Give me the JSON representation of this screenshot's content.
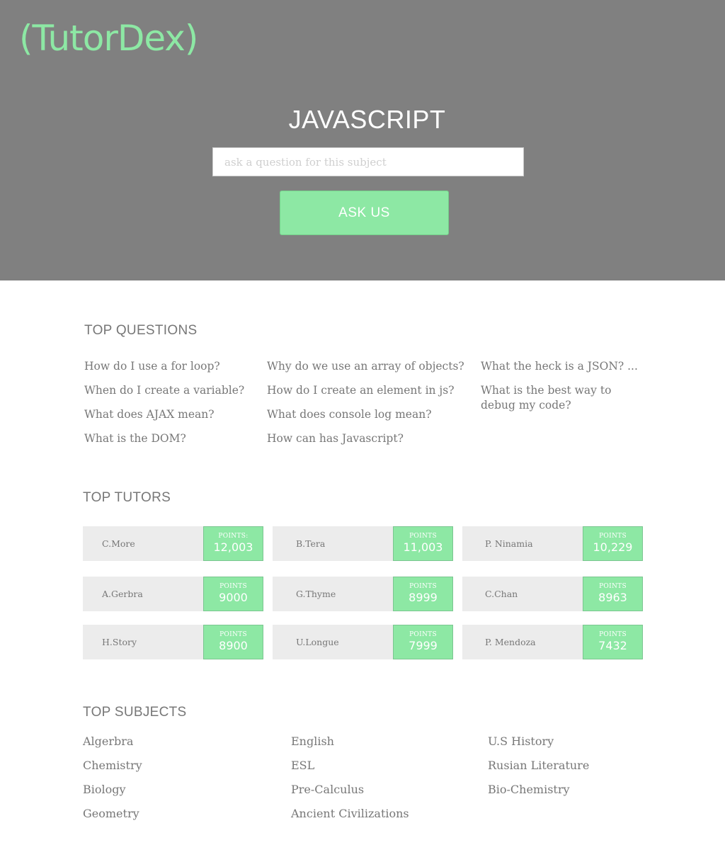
{
  "brand": {
    "logo": "(TutorDex)"
  },
  "hero": {
    "subject_title": "JAVASCRIPT",
    "search": {
      "value": "",
      "placeholder": "ask a question for this subject"
    },
    "ask_button_label": "ASK US"
  },
  "colors": {
    "header_bg": "#808080",
    "accent": "#8de8a4",
    "card_bg": "#ececec",
    "text": "#777777"
  },
  "top_questions": {
    "heading": "TOP QUESTIONS",
    "columns": [
      [
        "How do I use a for loop?",
        "When do I create a variable?",
        "What does AJAX mean?",
        "What is the DOM?"
      ],
      [
        "Why do we use an array of objects?",
        "How do I create an element in js?",
        "What does console log mean?",
        "How can has Javascript?"
      ],
      [
        "What the heck is a JSON? ...",
        "What is the best way to debug my code?"
      ]
    ]
  },
  "top_tutors": {
    "heading": "TOP TUTORS",
    "tutors": [
      {
        "name": "C.More",
        "points_label": "POINTS:",
        "points": "12,003"
      },
      {
        "name": "B.Tera",
        "points_label": "POINTS",
        "points": "11,003"
      },
      {
        "name": "P. Ninamia",
        "points_label": "POINTS",
        "points": "10,229"
      },
      {
        "name": "A.Gerbra",
        "points_label": "POINTS",
        "points": "9000"
      },
      {
        "name": "G.Thyme",
        "points_label": "POINTS",
        "points": "8999"
      },
      {
        "name": "C.Chan",
        "points_label": "POINTS",
        "points": "8963"
      },
      {
        "name": "H.Story",
        "points_label": "POINTS",
        "points": "8900"
      },
      {
        "name": "U.Longue",
        "points_label": "POINTS",
        "points": "7999"
      },
      {
        "name": "P. Mendoza",
        "points_label": "POINTS",
        "points": "7432"
      }
    ]
  },
  "top_subjects": {
    "heading": "TOP SUBJECTS",
    "columns": [
      [
        "Algerbra",
        "Chemistry",
        "Biology",
        "Geometry"
      ],
      [
        "English",
        "ESL",
        "Pre-Calculus",
        "Ancient Civilizations"
      ],
      [
        "U.S History",
        "Rusian Literature",
        "Bio-Chemistry"
      ]
    ]
  }
}
